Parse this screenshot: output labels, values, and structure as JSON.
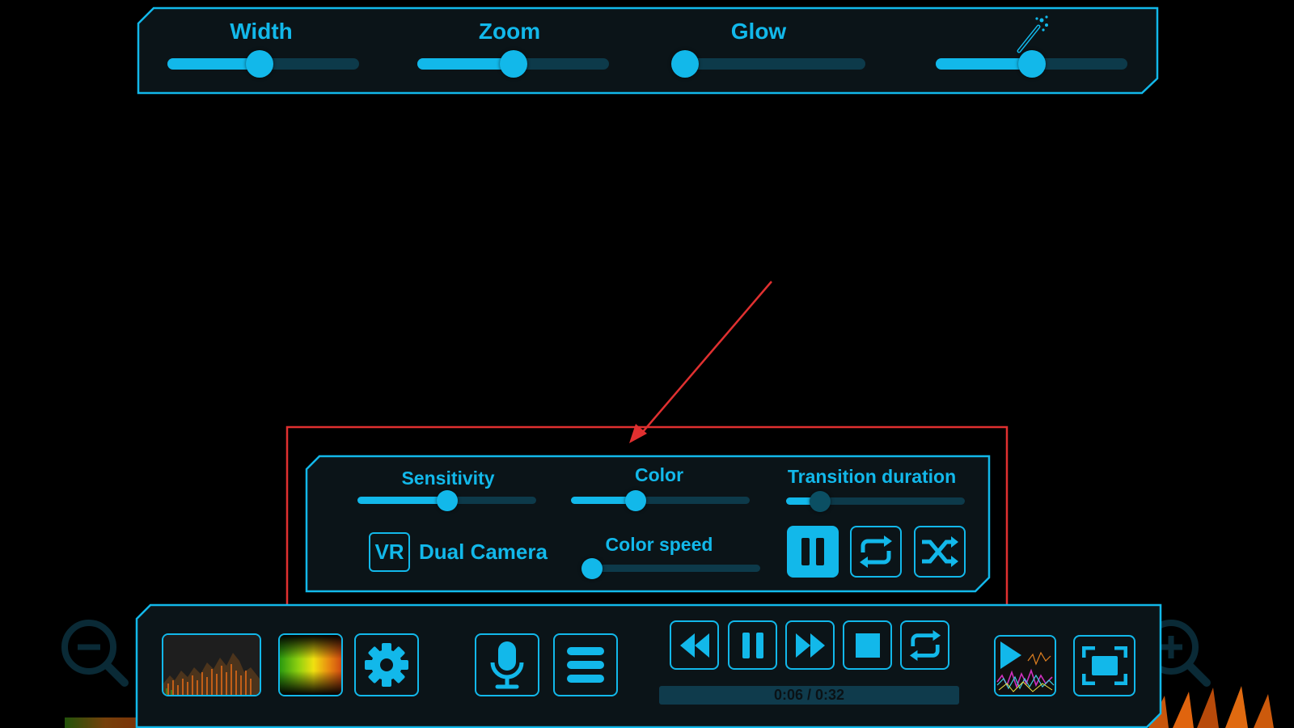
{
  "top_panel": {
    "width_label": "Width",
    "zoom_label": "Zoom",
    "glow_label": "Glow",
    "effect_icon": "magic-wand-icon",
    "width_value": 0.48,
    "zoom_value": 0.5,
    "glow_value": 0.0,
    "effect_value": 0.5
  },
  "settings_panel": {
    "sensitivity_label": "Sensitivity",
    "color_label": "Color",
    "transition_label": "Transition duration",
    "color_speed_label": "Color speed",
    "vr_label": "VR",
    "dual_camera_label": "Dual Camera",
    "sensitivity_value": 0.5,
    "color_value": 0.36,
    "transition_value": 0.19,
    "color_speed_value": 0.0,
    "playback_mode_icons": [
      "pause-icon",
      "repeat-icon",
      "shuffle-icon"
    ]
  },
  "bottom_bar": {
    "time_text": "0:06 / 0:32",
    "progress_value": 0.19,
    "icons": [
      "zoom-out-icon",
      "spectrum-thumbnail",
      "color-gradient-thumbnail",
      "gear-icon",
      "microphone-icon",
      "menu-icon",
      "rewind-icon",
      "pause-icon",
      "fast-forward-icon",
      "stop-icon",
      "repeat-icon",
      "visualizer-play-thumbnail",
      "fullscreen-icon",
      "zoom-in-icon"
    ]
  },
  "colors": {
    "accent": "#12b8ea",
    "track": "#0d3a4a",
    "panel_bg": "#0b1418",
    "annotation": "#e03030"
  }
}
